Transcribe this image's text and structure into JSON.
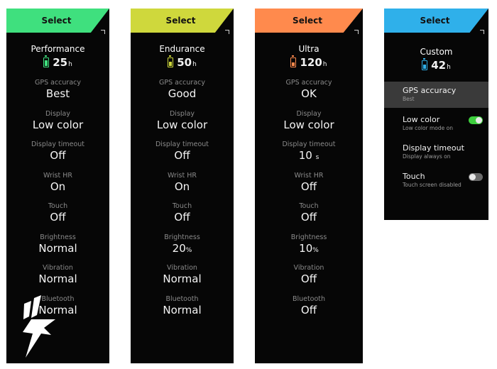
{
  "header_label": "Select",
  "panels": [
    {
      "accent": "#3fe07e",
      "name": "Performance",
      "hours": "25",
      "unit": "h",
      "battery_color": "#3fe07e",
      "settings": [
        {
          "label": "GPS accuracy",
          "value": "Best"
        },
        {
          "label": "Display",
          "value": "Low color"
        },
        {
          "label": "Display timeout",
          "value": "Off"
        },
        {
          "label": "Wrist HR",
          "value": "On"
        },
        {
          "label": "Touch",
          "value": "Off"
        },
        {
          "label": "Brightness",
          "value": "Normal"
        },
        {
          "label": "Vibration",
          "value": "Normal"
        },
        {
          "label": "Bluetooth",
          "value": "Normal"
        }
      ]
    },
    {
      "accent": "#cfd83c",
      "name": "Endurance",
      "hours": "50",
      "unit": "h",
      "battery_color": "#cfd83c",
      "settings": [
        {
          "label": "GPS accuracy",
          "value": "Good"
        },
        {
          "label": "Display",
          "value": "Low color"
        },
        {
          "label": "Display timeout",
          "value": "Off"
        },
        {
          "label": "Wrist HR",
          "value": "On"
        },
        {
          "label": "Touch",
          "value": "Off"
        },
        {
          "label": "Brightness",
          "value": "20",
          "unit": "%"
        },
        {
          "label": "Vibration",
          "value": "Normal"
        },
        {
          "label": "Bluetooth",
          "value": "Normal"
        }
      ]
    },
    {
      "accent": "#ff8a4d",
      "name": "Ultra",
      "hours": "120",
      "unit": "h",
      "battery_color": "#ff8a4d",
      "settings": [
        {
          "label": "GPS accuracy",
          "value": "OK"
        },
        {
          "label": "Display",
          "value": "Low color"
        },
        {
          "label": "Display timeout",
          "value": "10",
          "unit": "s"
        },
        {
          "label": "Wrist HR",
          "value": "Off"
        },
        {
          "label": "Touch",
          "value": "Off"
        },
        {
          "label": "Brightness",
          "value": "10",
          "unit": "%"
        },
        {
          "label": "Vibration",
          "value": "Off"
        },
        {
          "label": "Bluetooth",
          "value": "Off"
        }
      ]
    }
  ],
  "custom": {
    "accent": "#2fb0ea",
    "name": "Custom",
    "hours": "42",
    "unit": "h",
    "battery_color": "#2fb0ea",
    "items": [
      {
        "title": "GPS accuracy",
        "sub": "Best",
        "selected": true
      },
      {
        "title": "Low color",
        "sub": "Low color mode on",
        "toggle": "on"
      },
      {
        "title": "Display timeout",
        "sub": "Display always on"
      },
      {
        "title": "Touch",
        "sub": "Touch screen disabled",
        "toggle": "off"
      }
    ]
  }
}
